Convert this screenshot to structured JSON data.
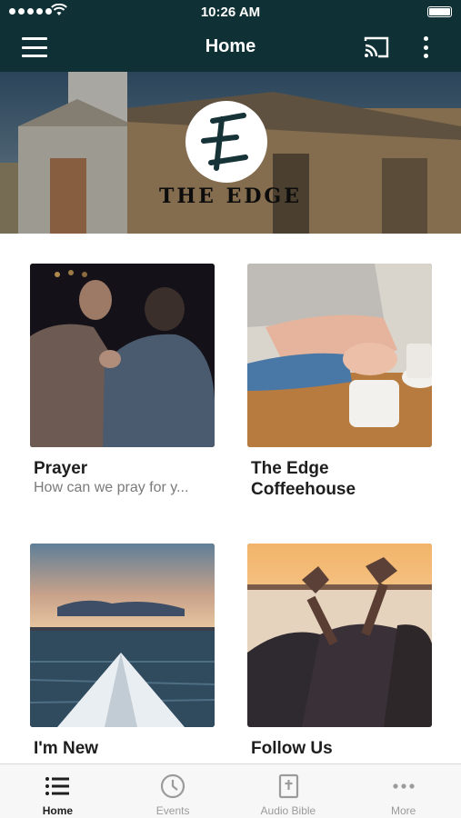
{
  "status_bar": {
    "time": "10:26 AM"
  },
  "nav": {
    "title": "Home"
  },
  "banner": {
    "logo_letter": "E",
    "logo_text": "The Edge"
  },
  "tiles": [
    {
      "title": "Prayer",
      "subtitle": "How can we pray for y..."
    },
    {
      "title": "The Edge Coffeehouse",
      "subtitle": ""
    },
    {
      "title": "I'm New",
      "subtitle": ""
    },
    {
      "title": "Follow Us",
      "subtitle": ""
    }
  ],
  "tab_bar": {
    "items": [
      {
        "label": "Home",
        "icon": "list-icon",
        "active": true
      },
      {
        "label": "Events",
        "icon": "clock-icon",
        "active": false
      },
      {
        "label": "Audio Bible",
        "icon": "bible-icon",
        "active": false
      },
      {
        "label": "More",
        "icon": "more-icon",
        "active": false
      }
    ]
  },
  "colors": {
    "header_bg": "#0f3034",
    "active_tab": "#1e1e1e",
    "inactive_tab": "#9b9b9b"
  }
}
